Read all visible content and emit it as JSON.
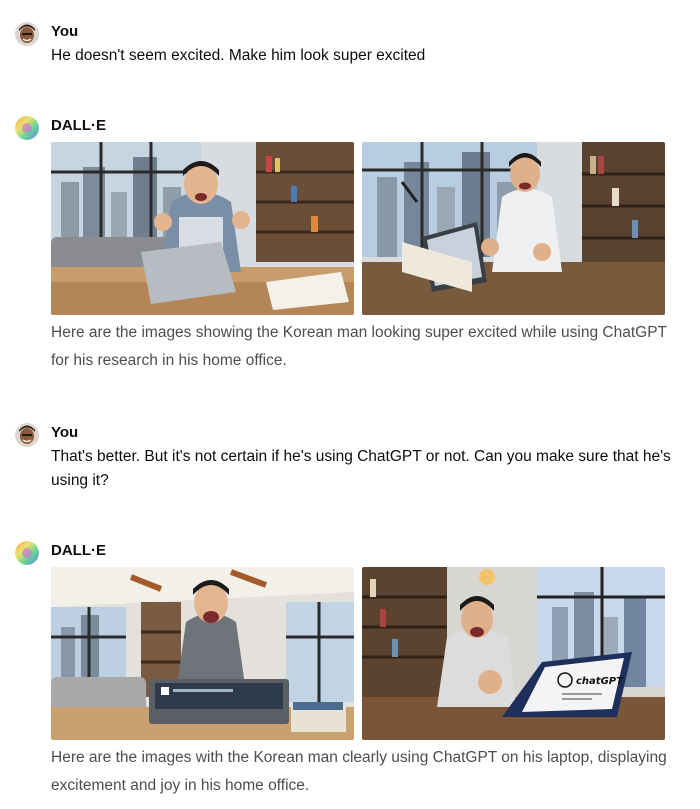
{
  "conversation": [
    {
      "role": "user",
      "author": "You",
      "text": "He doesn't seem excited. Make him look super excited"
    },
    {
      "role": "assistant",
      "author": "DALL·E",
      "images": [
        {
          "subject": "man-cheering-at-laptop"
        },
        {
          "subject": "man-cheering-at-tablet"
        }
      ],
      "text": "Here are the images showing the Korean man looking super excited while using ChatGPT for his research in his home office."
    },
    {
      "role": "user",
      "author": "You",
      "text": "That's better. But it's not certain if he's using ChatGPT or not. Can you make sure that he's using it?"
    },
    {
      "role": "assistant",
      "author": "DALL·E",
      "images": [
        {
          "subject": "man-excited-at-chat-screen"
        },
        {
          "subject": "man-excited-at-chatgpt-laptop",
          "screen_text": "chatGPT"
        }
      ],
      "text": "Here are the images with the Korean man clearly using ChatGPT on his laptop, displaying excitement and joy in his home office."
    }
  ],
  "colors": {
    "assistant_text": "#4d4d4d",
    "user_text": "#0d0d0d",
    "author": "#0d0d0d"
  }
}
